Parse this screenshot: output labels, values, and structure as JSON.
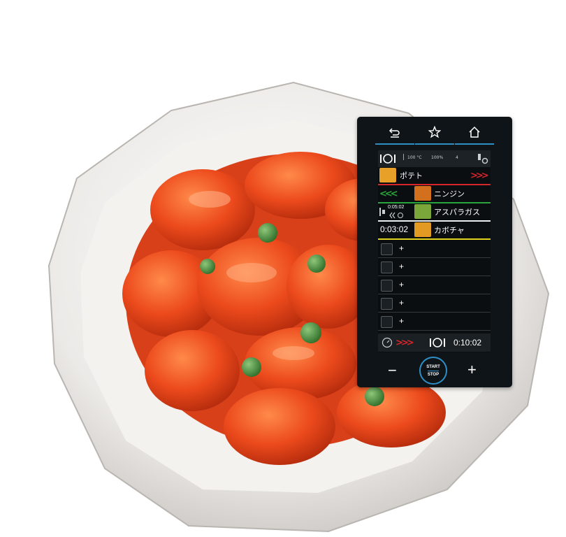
{
  "device": {
    "status_bar": {
      "temp": "100 °C",
      "steam": "100%",
      "fan": "4"
    },
    "rows": [
      {
        "name": "ポテト",
        "line_color": "#d6262c"
      },
      {
        "name": "ニンジン",
        "line_color": "#2aa53c"
      },
      {
        "name": "アスパラガス",
        "timer": "0:05:02",
        "line_color": "#e9eef0"
      },
      {
        "name": "カボチャ",
        "timer": "0:03:02",
        "line_color": "#e3d21c"
      }
    ],
    "empty_slots": [
      "+",
      "+",
      "+",
      "+",
      "+"
    ],
    "footer_timer": "0:10:02",
    "minus_label": "−",
    "plus_label": "+",
    "start_label": "START",
    "stop_label": "STOP"
  },
  "colors": {
    "accent": "#2d8fc4",
    "red": "#d6262c",
    "green": "#2aa53c",
    "yellow": "#e3d21c"
  },
  "icons": [
    "back-icon",
    "star-icon",
    "home-icon",
    "oven-icon",
    "settings-icon",
    "clock-icon",
    "tray-icon"
  ]
}
